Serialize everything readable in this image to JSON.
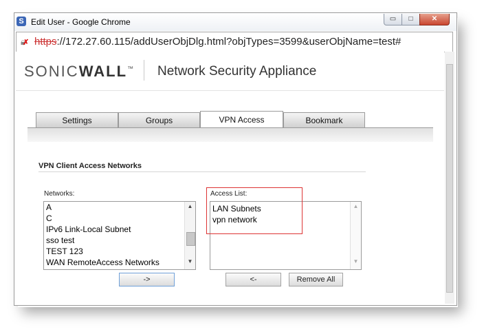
{
  "window": {
    "title": "Edit User - Google Chrome",
    "controls": {
      "minimize": "▭",
      "maximize": "□",
      "close": "✕"
    }
  },
  "address_bar": {
    "protocol": "https",
    "rest": "://172.27.60.115/addUserObjDlg.html?objTypes=3599&userObjName=test#"
  },
  "brand": {
    "logo_light": "SONIC",
    "logo_bold": "WALL",
    "logo_mark": "™",
    "app_name": "Network Security Appliance"
  },
  "tabs": [
    {
      "label": "Settings",
      "active": false
    },
    {
      "label": "Groups",
      "active": false
    },
    {
      "label": "VPN Access",
      "active": true
    },
    {
      "label": "Bookmark",
      "active": false
    }
  ],
  "section": {
    "title": "VPN Client Access Networks"
  },
  "networks": {
    "label": "Networks:",
    "items": [
      "A",
      "C",
      "IPv6 Link-Local Subnet",
      "sso test",
      "TEST 123",
      "WAN RemoteAccess Networks"
    ]
  },
  "access_list": {
    "label": "Access List:",
    "items": [
      "LAN Subnets",
      "vpn network"
    ]
  },
  "buttons": {
    "add": "->",
    "remove": "<-",
    "remove_all": "Remove All"
  },
  "icons": {
    "browser": "chrome-icon",
    "insecure": "broken-lock-icon",
    "scroll_up": "▲",
    "scroll_down": "▼"
  }
}
